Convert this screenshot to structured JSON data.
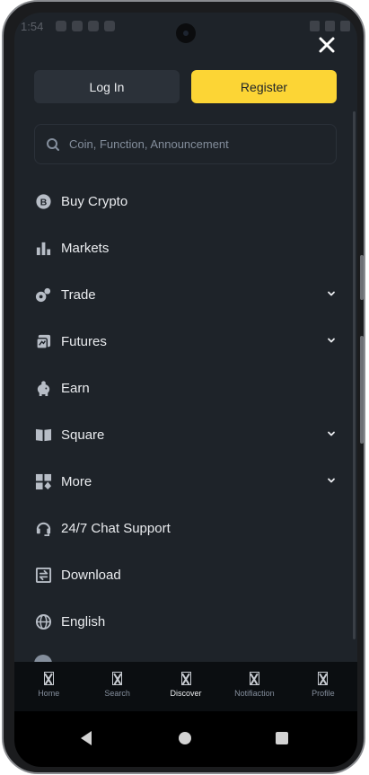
{
  "status_bar": {
    "time": "1:54"
  },
  "header": {
    "close_icon": "close-icon"
  },
  "auth": {
    "login_label": "Log In",
    "register_label": "Register"
  },
  "search": {
    "placeholder": "Coin, Function, Announcement"
  },
  "menu": [
    {
      "label": "Buy Crypto",
      "icon": "bitcoin-icon",
      "expandable": false
    },
    {
      "label": "Markets",
      "icon": "bar-chart-icon",
      "expandable": false
    },
    {
      "label": "Trade",
      "icon": "trade-icon",
      "expandable": true
    },
    {
      "label": "Futures",
      "icon": "futures-icon",
      "expandable": true
    },
    {
      "label": "Earn",
      "icon": "piggy-bank-icon",
      "expandable": false
    },
    {
      "label": "Square",
      "icon": "book-icon",
      "expandable": true
    },
    {
      "label": "More",
      "icon": "grid-icon",
      "expandable": true
    },
    {
      "label": "24/7 Chat Support",
      "icon": "headset-icon",
      "expandable": false
    },
    {
      "label": "Download",
      "icon": "download-icon",
      "expandable": false
    },
    {
      "label": "English",
      "icon": "globe-icon",
      "expandable": false
    }
  ],
  "tab_bar": {
    "tabs": [
      {
        "label": "Home",
        "active": false
      },
      {
        "label": "Search",
        "active": false
      },
      {
        "label": "Discover",
        "active": true
      },
      {
        "label": "Notifiaction",
        "active": false
      },
      {
        "label": "Profile",
        "active": false
      }
    ]
  },
  "colors": {
    "background": "#1e2329",
    "accent": "#fcd535",
    "text": "#eaecef",
    "muted": "#848e9c"
  }
}
